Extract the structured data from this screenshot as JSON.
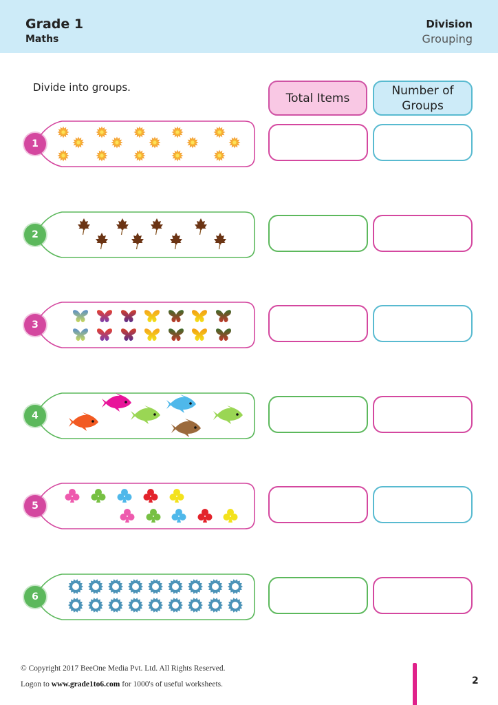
{
  "header": {
    "grade": "Grade 1",
    "subject": "Maths",
    "topic": "Division",
    "subtopic": "Grouping"
  },
  "instruction": "Divide into groups.",
  "columns": {
    "total_items": "Total Items",
    "number_of_groups_line1": "Number of",
    "number_of_groups_line2": "Groups"
  },
  "colors": {
    "pink": "#d4479f",
    "green": "#5cb85c",
    "blue": "#58bad0",
    "header_bg": "#cdebf8"
  },
  "questions": [
    {
      "number": "1",
      "theme": "pink",
      "item": "sun-icon",
      "count": 15,
      "groups": 5,
      "answer_total": "",
      "answer_groups": "",
      "total_box": "pink",
      "groups_box": "blue"
    },
    {
      "number": "2",
      "theme": "green",
      "item": "maple-leaf-icon",
      "count": 8,
      "groups": 4,
      "answer_total": "",
      "answer_groups": "",
      "total_box": "green",
      "groups_box": "pink"
    },
    {
      "number": "3",
      "theme": "pink",
      "item": "butterfly-icon",
      "count": 14,
      "groups": 7,
      "answer_total": "",
      "answer_groups": "",
      "total_box": "pink",
      "groups_box": "blue"
    },
    {
      "number": "4",
      "theme": "green",
      "item": "fish-icon",
      "count": 6,
      "groups": 3,
      "answer_total": "",
      "answer_groups": "",
      "total_box": "green",
      "groups_box": "pink"
    },
    {
      "number": "5",
      "theme": "pink",
      "item": "club-icon",
      "count": 10,
      "groups": 2,
      "answer_total": "",
      "answer_groups": "",
      "total_box": "pink",
      "groups_box": "blue"
    },
    {
      "number": "6",
      "theme": "green",
      "item": "gear-icon",
      "count": 18,
      "groups": 9,
      "answer_total": "",
      "answer_groups": "",
      "total_box": "green",
      "groups_box": "pink"
    }
  ],
  "item_colors": {
    "butterflies": [
      [
        "#5b8fc9",
        "#c9d85a"
      ],
      [
        "#e8402a",
        "#7b3fb0"
      ],
      [
        "#d3402a",
        "#5a2d8a"
      ],
      [
        "#f6a31c",
        "#f1e21a"
      ],
      [
        "#3d6b2a",
        "#c0392b"
      ],
      [
        "#f39c12",
        "#f4e11b"
      ],
      [
        "#3d6b2a",
        "#c0392b"
      ]
    ],
    "fish": [
      "#f25a22",
      "#e8159a",
      "#9ad654",
      "#4fb8ea",
      "#9b6a3c",
      "#9ad654"
    ],
    "clubs": [
      "#ee5aae",
      "#77c043",
      "#4fb8ea",
      "#e3232b",
      "#f3e21c"
    ]
  },
  "footer": {
    "copyright": "© Copyright 2017 BeeOne Media Pvt. Ltd. All Rights Reserved.",
    "logon_prefix": "Logon to ",
    "website": "www.grade1to6.com",
    "logon_suffix": " for 1000's of useful worksheets.",
    "page_number": "2"
  }
}
